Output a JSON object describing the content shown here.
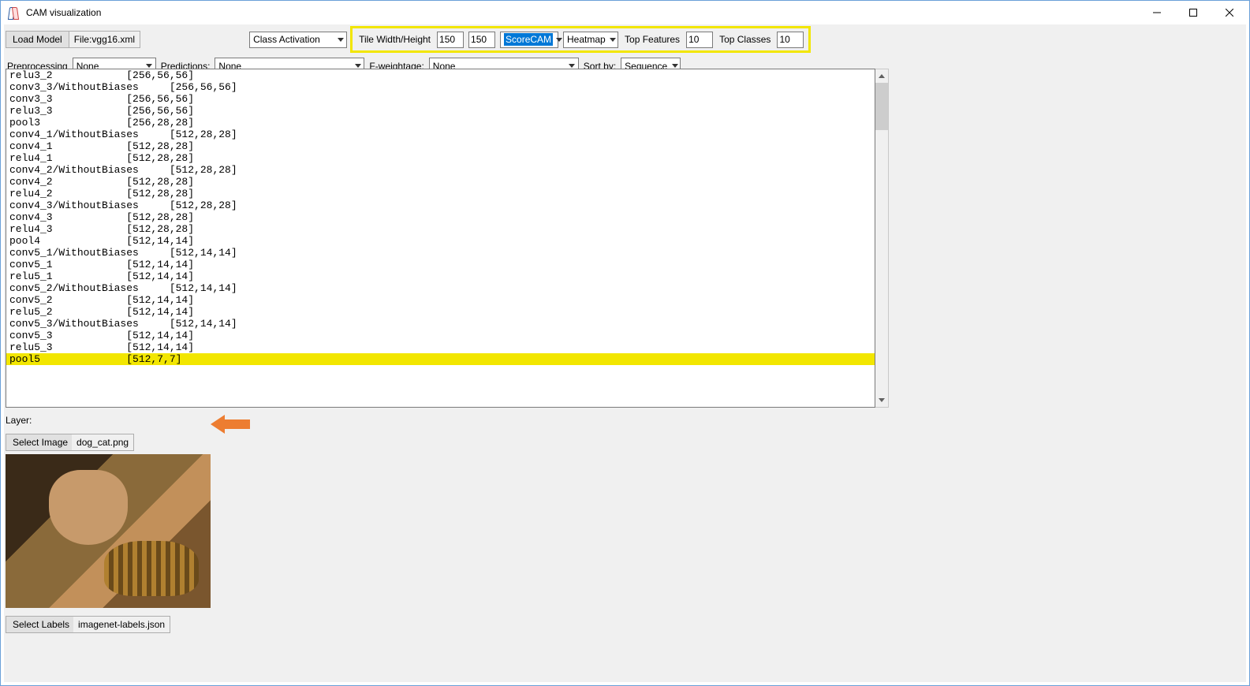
{
  "window": {
    "title": "CAM visualization"
  },
  "toolbar": {
    "load_model_label": "Load Model",
    "file_prefix": "File: ",
    "file_name": "vgg16.xml",
    "mode_select": "Class Activation",
    "tile_label": "Tile Width/Height",
    "tile_w": "150",
    "tile_h": "150",
    "method_select": "ScoreCAM",
    "overlay_select": "Heatmap",
    "top_features_label": "Top Features",
    "top_features": "10",
    "top_classes_label": "Top Classes",
    "top_classes": "10"
  },
  "row2": {
    "preproc_label": "Preprocessing",
    "preproc_value": "None",
    "pred_label": "Predictions:",
    "pred_value": "None",
    "fweight_label": "F-weightage:",
    "fweight_value": "None",
    "sort_label": "Sort by:",
    "sort_value": "Sequence"
  },
  "layers": [
    {
      "name": "relu3_2",
      "shape": "[256,56,56]"
    },
    {
      "name": "conv3_3/WithoutBiases",
      "shape": "[256,56,56]"
    },
    {
      "name": "conv3_3",
      "shape": "[256,56,56]"
    },
    {
      "name": "relu3_3",
      "shape": "[256,56,56]"
    },
    {
      "name": "pool3",
      "shape": "[256,28,28]"
    },
    {
      "name": "conv4_1/WithoutBiases",
      "shape": "[512,28,28]"
    },
    {
      "name": "conv4_1",
      "shape": "[512,28,28]"
    },
    {
      "name": "relu4_1",
      "shape": "[512,28,28]"
    },
    {
      "name": "conv4_2/WithoutBiases",
      "shape": "[512,28,28]"
    },
    {
      "name": "conv4_2",
      "shape": "[512,28,28]"
    },
    {
      "name": "relu4_2",
      "shape": "[512,28,28]"
    },
    {
      "name": "conv4_3/WithoutBiases",
      "shape": "[512,28,28]"
    },
    {
      "name": "conv4_3",
      "shape": "[512,28,28]"
    },
    {
      "name": "relu4_3",
      "shape": "[512,28,28]"
    },
    {
      "name": "pool4",
      "shape": "[512,14,14]"
    },
    {
      "name": "conv5_1/WithoutBiases",
      "shape": "[512,14,14]"
    },
    {
      "name": "conv5_1",
      "shape": "[512,14,14]"
    },
    {
      "name": "relu5_1",
      "shape": "[512,14,14]"
    },
    {
      "name": "conv5_2/WithoutBiases",
      "shape": "[512,14,14]"
    },
    {
      "name": "conv5_2",
      "shape": "[512,14,14]"
    },
    {
      "name": "relu5_2",
      "shape": "[512,14,14]"
    },
    {
      "name": "conv5_3/WithoutBiases",
      "shape": "[512,14,14]"
    },
    {
      "name": "conv5_3",
      "shape": "[512,14,14]"
    },
    {
      "name": "relu5_3",
      "shape": "[512,14,14]"
    },
    {
      "name": "pool5",
      "shape": "[512,7,7]",
      "selected": true
    }
  ],
  "below": {
    "layer_label": "Layer:",
    "select_image_label": "Select Image",
    "image_file": "dog_cat.png",
    "select_labels_label": "Select Labels",
    "labels_file": "imagenet-labels.json"
  }
}
